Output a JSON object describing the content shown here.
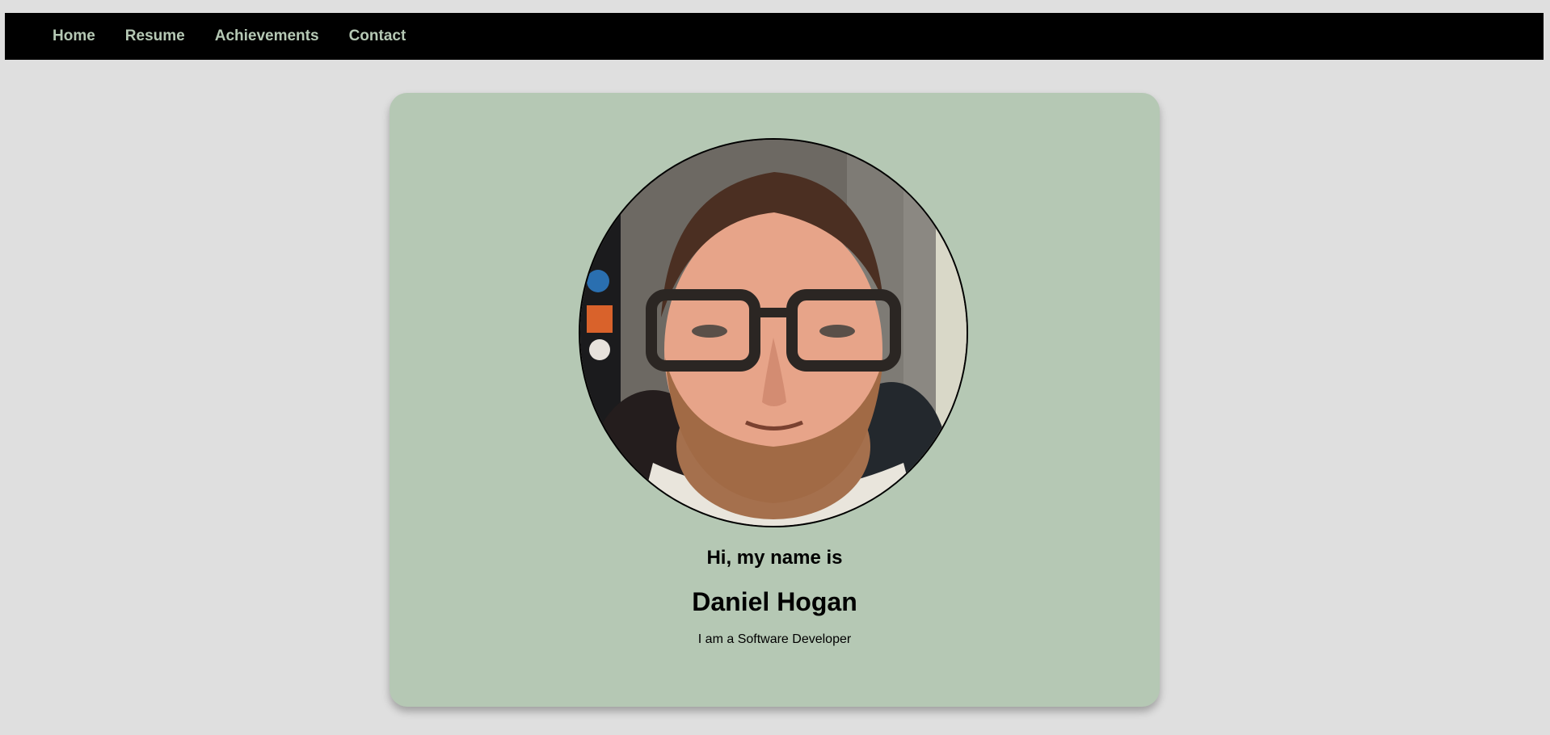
{
  "nav": {
    "items": [
      {
        "label": "Home"
      },
      {
        "label": "Resume"
      },
      {
        "label": "Achievements"
      },
      {
        "label": "Contact"
      }
    ]
  },
  "profile": {
    "greeting": "Hi, my name is",
    "name": "Daniel Hogan",
    "tagline": "I am a Software Developer",
    "photo_icon": "profile-photo"
  },
  "colors": {
    "page_bg": "#dfdfdf",
    "nav_bg": "#000000",
    "nav_text": "#b5c8b4",
    "card_bg": "#b5c8b4",
    "text": "#000000"
  }
}
